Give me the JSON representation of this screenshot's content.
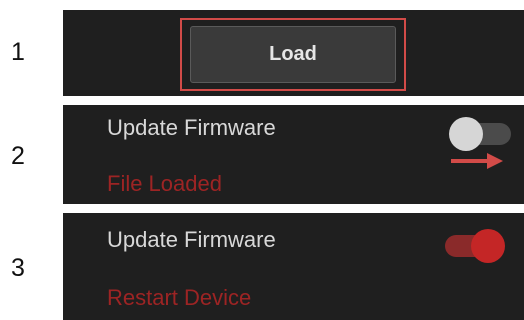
{
  "steps": {
    "one": "1",
    "two": "2",
    "three": "3"
  },
  "step1": {
    "load_label": "Load"
  },
  "step2": {
    "title": "Update Firmware",
    "status": "File Loaded",
    "toggle_state": "off"
  },
  "step3": {
    "title": "Update Firmware",
    "status": "Restart Device",
    "toggle_state": "on"
  },
  "colors": {
    "panel_bg": "#1f1f1f",
    "highlight": "#d24b48",
    "status_text": "#9d2424",
    "toggle_on": "#c42626"
  }
}
